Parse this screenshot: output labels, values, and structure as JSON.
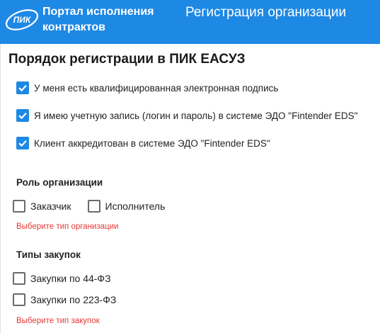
{
  "header": {
    "logo_text": "ПИК",
    "portal_title_line1": "Портал исполнения",
    "portal_title_line2": "контрактов",
    "page_title": "Регистрация организации",
    "background": "#1e88e5"
  },
  "registration": {
    "title": "Порядок регистрации в ПИК ЕАСУЗ",
    "conditions": [
      {
        "label": "У меня есть квалифицированная электронная подпись",
        "checked": true
      },
      {
        "label": "Я имею учетную запись (логин и пароль) в системе ЭДО \"Fintender EDS\"",
        "checked": true
      },
      {
        "label": "Клиент аккредитован в системе ЭДО \"Fintender EDS\"",
        "checked": true
      }
    ]
  },
  "role": {
    "title": "Роль организации",
    "options": [
      {
        "label": "Заказчик",
        "checked": false
      },
      {
        "label": "Исполнитель",
        "checked": false
      }
    ],
    "error": "Выберите тип организации"
  },
  "procurement": {
    "title": "Типы закупок",
    "options": [
      {
        "label": "Закупки по 44-ФЗ",
        "checked": false
      },
      {
        "label": "Закупки по 223-ФЗ",
        "checked": false
      }
    ],
    "error": "Выберите тип закупок"
  },
  "colors": {
    "accent": "#1e88e5",
    "error": "#e53935",
    "checkbox_border": "#6b6b6b"
  },
  "icons": {
    "logo": "pik-logo-icon",
    "check": "checkmark-icon"
  }
}
